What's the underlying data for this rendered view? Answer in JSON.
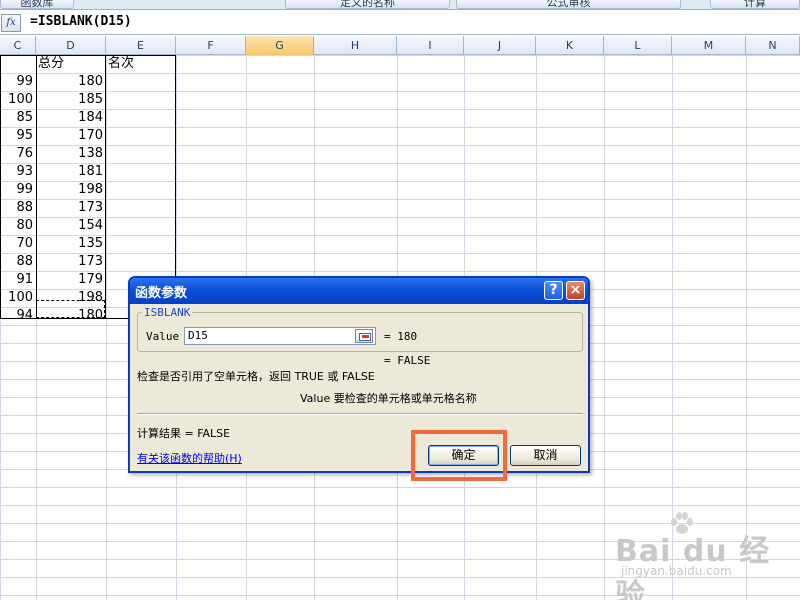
{
  "ribbon": {
    "buttons": [
      "函数库",
      "定义的名称",
      "公式审核",
      "计算"
    ]
  },
  "formula_bar": {
    "fx_icon": "function-icon",
    "formula": "=ISBLANK(D15)"
  },
  "columns": [
    "C",
    "D",
    "E",
    "F",
    "G",
    "H",
    "I",
    "J",
    "K",
    "L",
    "M",
    "N"
  ],
  "active_column": "G",
  "sheet": {
    "header_d": "总分",
    "header_e": "名次",
    "rows": [
      {
        "c": "99",
        "d": "180"
      },
      {
        "c": "100",
        "d": "185"
      },
      {
        "c": "85",
        "d": "184"
      },
      {
        "c": "95",
        "d": "170"
      },
      {
        "c": "76",
        "d": "138"
      },
      {
        "c": "93",
        "d": "181"
      },
      {
        "c": "99",
        "d": "198"
      },
      {
        "c": "88",
        "d": "173"
      },
      {
        "c": "80",
        "d": "154"
      },
      {
        "c": "70",
        "d": "135"
      },
      {
        "c": "88",
        "d": "173"
      },
      {
        "c": "91",
        "d": "179"
      },
      {
        "c": "100",
        "d": "198"
      },
      {
        "c": "94",
        "d": "180"
      }
    ]
  },
  "dialog": {
    "title": "函数参数",
    "help_icon": "?",
    "close_icon": "×",
    "function_name": "ISBLANK",
    "arg_label": "Value",
    "arg_value": "D15",
    "arg_result": "= 180",
    "fn_result": "= FALSE",
    "description": "检查是否引用了空单元格，返回 TRUE 或 FALSE",
    "arg_description": "Value  要检查的单元格或单元格名称",
    "calc_result": "计算结果 =  FALSE",
    "help_link": "有关该函数的帮助(H)",
    "ok": "确定",
    "cancel": "取消"
  },
  "watermark": {
    "main": "Bai du 经验",
    "sub": "jingyan.baidu.com"
  }
}
